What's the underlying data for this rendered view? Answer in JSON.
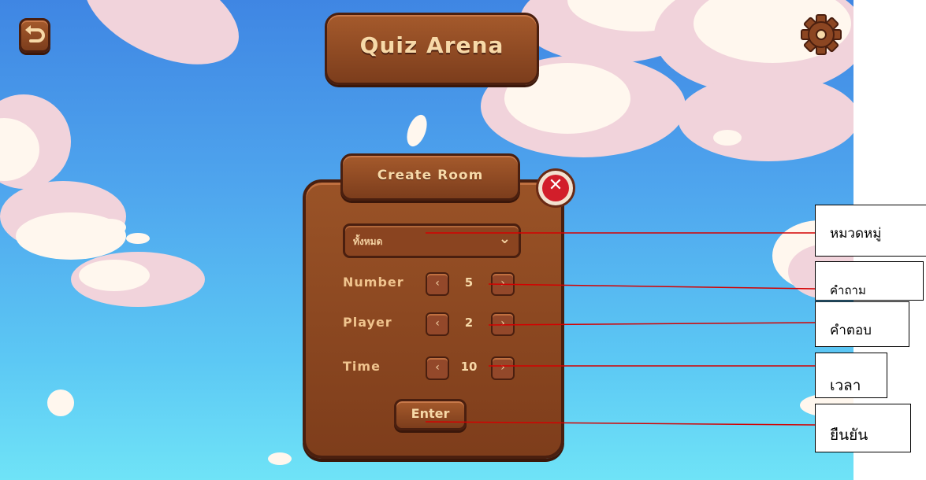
{
  "game": {
    "title": "Quiz Arena",
    "panel_title": "Create Room",
    "close_glyph": "✕",
    "category_value": "ทั้งหมด",
    "rows": [
      {
        "label": "Number",
        "value": "5"
      },
      {
        "label": "Player",
        "value": "2"
      },
      {
        "label": "Time",
        "value": "10"
      }
    ],
    "enter_label": "Enter"
  },
  "annotations": {
    "category": "หมวดหมู่",
    "question": "คำถาม",
    "answer": "คำตอบ",
    "time": "เวลา",
    "confirm": "ยืนยัน"
  },
  "icons": [
    "back-arrow-icon",
    "gear-icon",
    "close-icon",
    "chevron-down-icon",
    "chevron-left-icon",
    "chevron-right-icon"
  ],
  "colors": {
    "wood": "#8a4420",
    "line": "#d40000",
    "sky": "#4fa6ee"
  }
}
